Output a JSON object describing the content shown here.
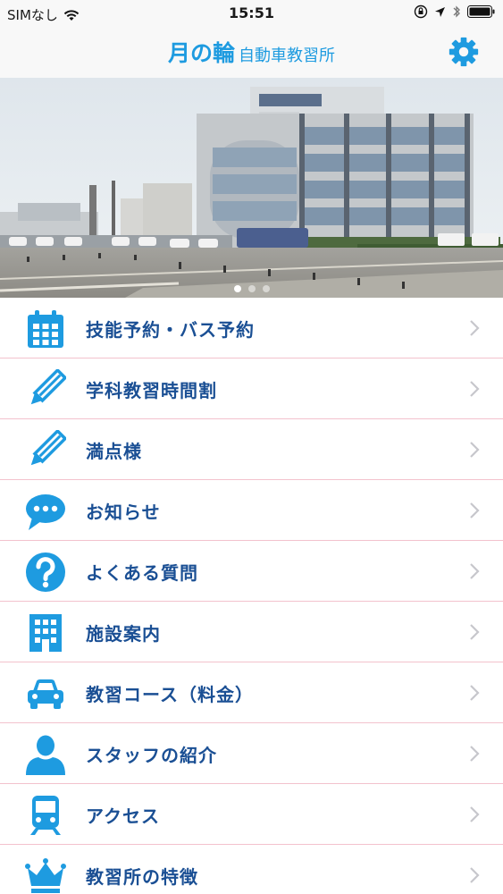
{
  "status_bar": {
    "carrier": "SIMなし",
    "time": "15:51"
  },
  "header": {
    "title_main": "月の輪",
    "title_sub": "自動車教習所",
    "settings_icon": "gear-icon",
    "accent_color": "#1e9be0"
  },
  "carousel": {
    "slide_count": 3,
    "active_index": 0
  },
  "menu": {
    "items": [
      {
        "label": "技能予約・バス予約",
        "icon": "calendar-icon"
      },
      {
        "label": "学科教習時間割",
        "icon": "pencil-icon"
      },
      {
        "label": "満点様",
        "icon": "pencil-icon"
      },
      {
        "label": "お知らせ",
        "icon": "speech-bubble-icon"
      },
      {
        "label": "よくある質問",
        "icon": "question-icon"
      },
      {
        "label": "施設案内",
        "icon": "building-icon"
      },
      {
        "label": "教習コース（料金）",
        "icon": "car-icon"
      },
      {
        "label": "スタッフの紹介",
        "icon": "person-icon"
      },
      {
        "label": "アクセス",
        "icon": "train-icon"
      },
      {
        "label": "教習所の特徴",
        "icon": "crown-icon"
      }
    ],
    "label_color": "#1a4f94",
    "icon_color": "#1e9be0",
    "divider_color": "#f3c2cd"
  }
}
